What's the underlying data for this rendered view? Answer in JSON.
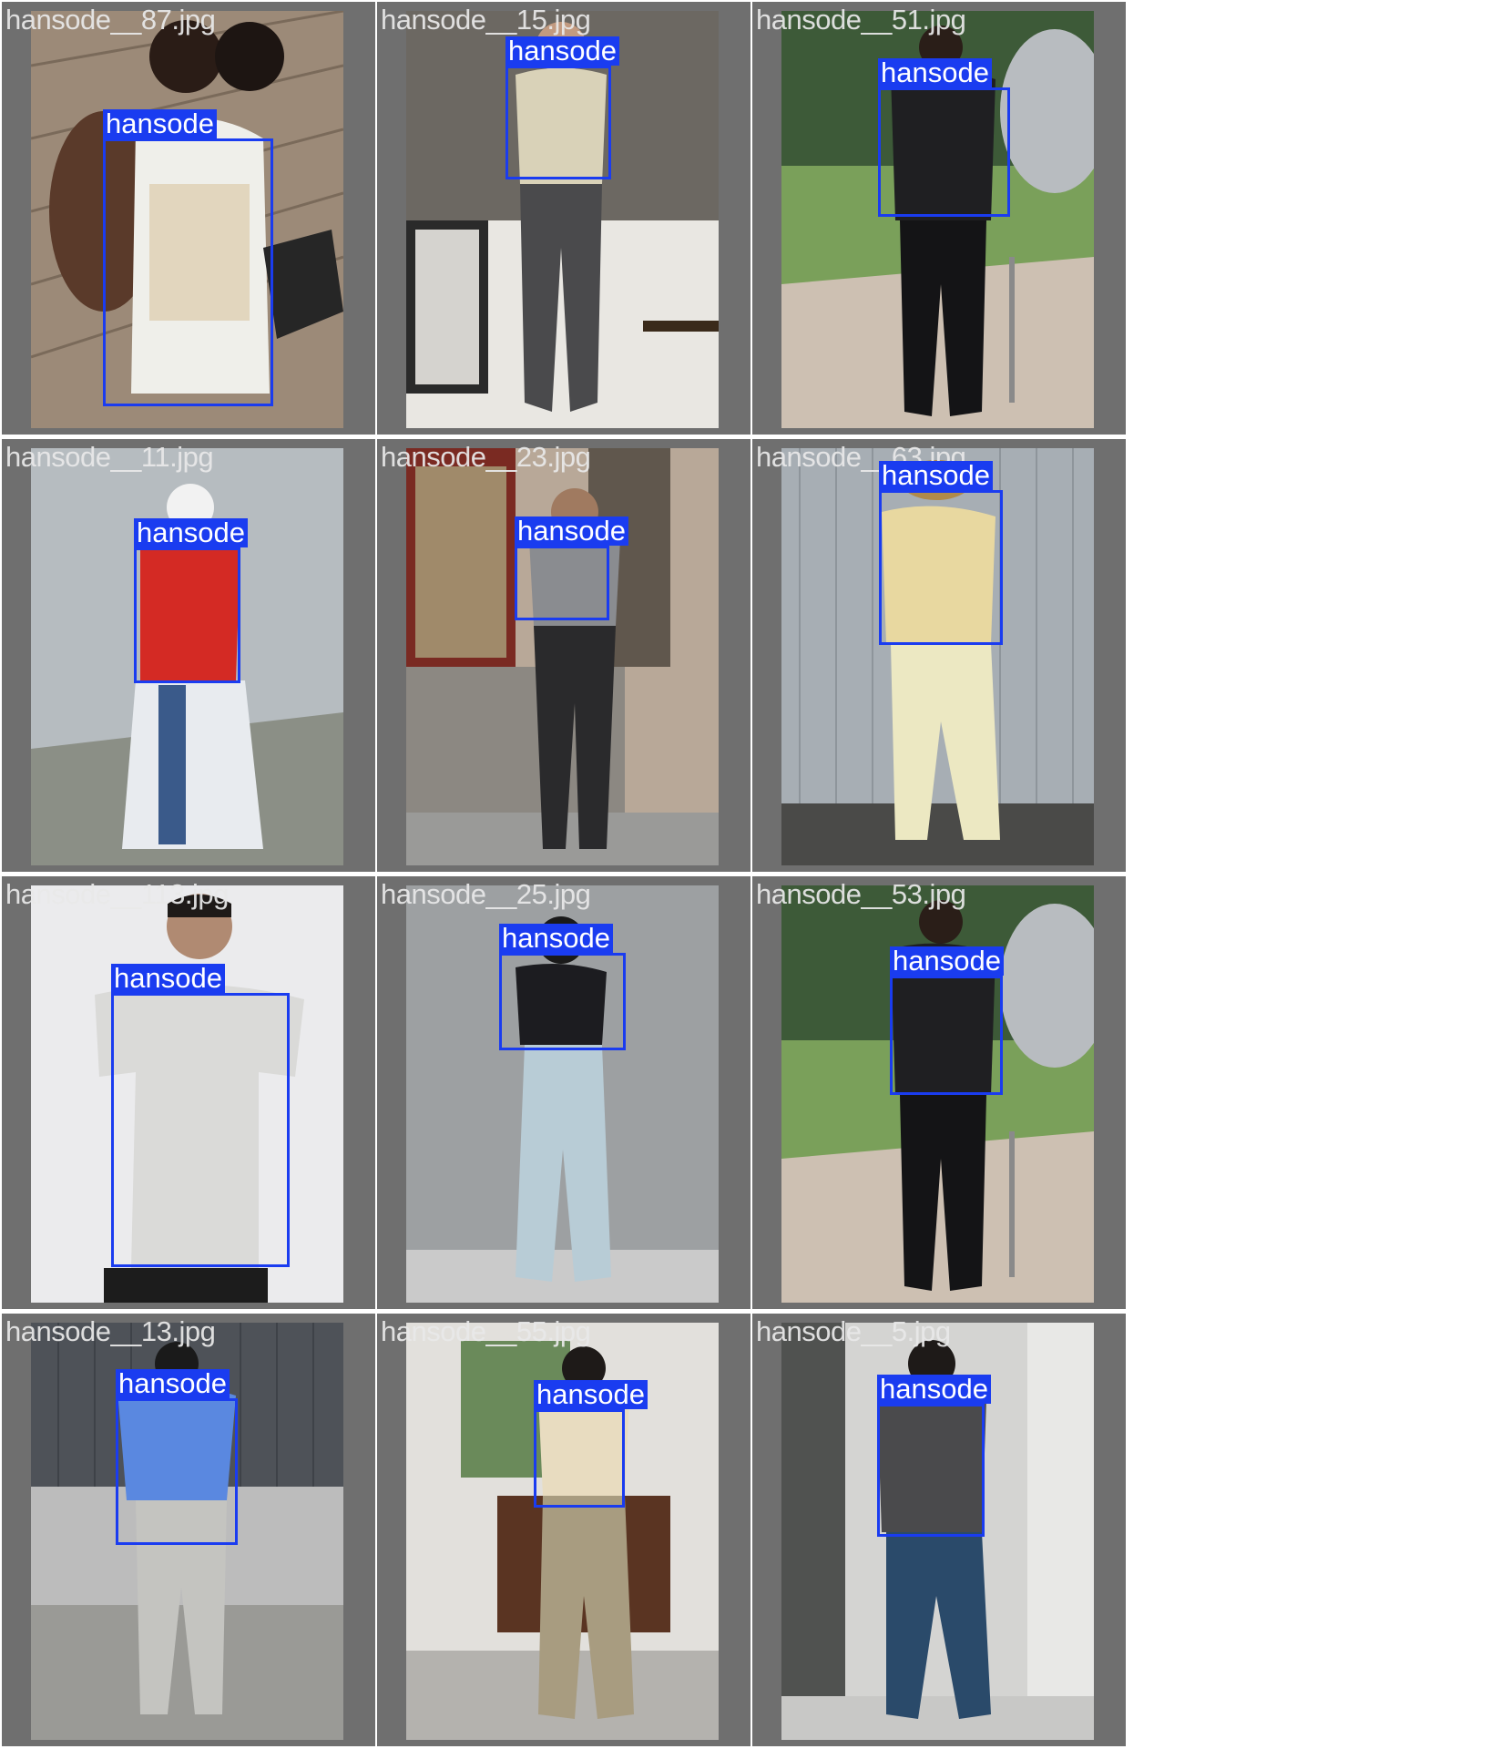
{
  "grid": {
    "tiles": [
      {
        "filename": "hansode__87.jpg",
        "label": "hansode",
        "scene": "deck"
      },
      {
        "filename": "hansode__15.jpg",
        "label": "hansode",
        "scene": "studio"
      },
      {
        "filename": "hansode__51.jpg",
        "label": "hansode",
        "scene": "park"
      },
      {
        "filename": "hansode__11.jpg",
        "label": "hansode",
        "scene": "wall"
      },
      {
        "filename": "hansode__23.jpg",
        "label": "hansode",
        "scene": "door"
      },
      {
        "filename": "hansode__63.jpg",
        "label": "hansode",
        "scene": "siding"
      },
      {
        "filename": "hansode__113.jpg",
        "label": "hansode",
        "scene": "white"
      },
      {
        "filename": "hansode__25.jpg",
        "label": "hansode",
        "scene": "concrete"
      },
      {
        "filename": "hansode__53.jpg",
        "label": "hansode",
        "scene": "park"
      },
      {
        "filename": "hansode__13.jpg",
        "label": "hansode",
        "scene": "building"
      },
      {
        "filename": "hansode__55.jpg",
        "label": "hansode",
        "scene": "room"
      },
      {
        "filename": "hansode__5.jpg",
        "label": "hansode",
        "scene": "lobby"
      }
    ]
  },
  "colors": {
    "box": "#1a3cf0",
    "tile_bg": "#6f6f6f",
    "filename_text": "#e9e9e9"
  }
}
